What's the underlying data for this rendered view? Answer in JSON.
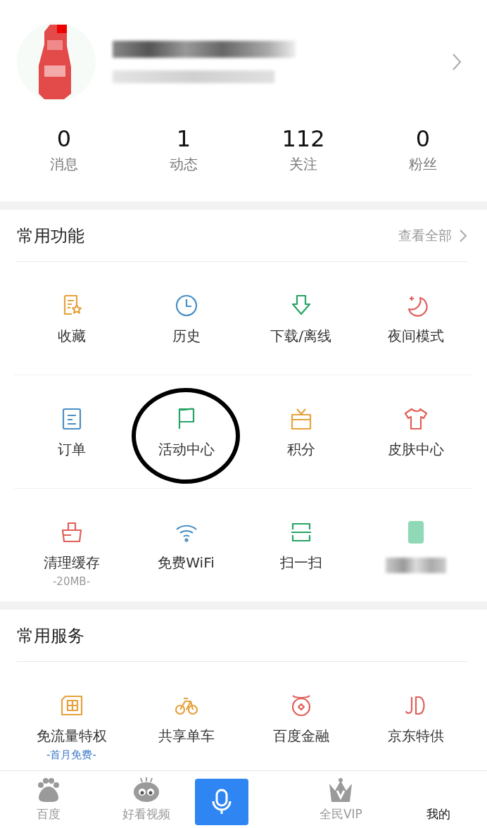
{
  "profile": {
    "stats": [
      {
        "value": "0",
        "label": "消息"
      },
      {
        "value": "1",
        "label": "动态"
      },
      {
        "value": "112",
        "label": "关注"
      },
      {
        "value": "0",
        "label": "粉丝"
      }
    ]
  },
  "common_functions": {
    "title": "常用功能",
    "view_all": "查看全部",
    "items": [
      {
        "label": "收藏",
        "kind": "bookmark",
        "color": "#e6a23c"
      },
      {
        "label": "历史",
        "kind": "clock",
        "color": "#4a8fc4"
      },
      {
        "label": "下载/离线",
        "kind": "download",
        "color": "#27a464"
      },
      {
        "label": "夜间模式",
        "kind": "moon",
        "color": "#e0605a"
      },
      {
        "label": "订单",
        "kind": "order",
        "color": "#4a8fc4"
      },
      {
        "label": "活动中心",
        "kind": "flag",
        "color": "#27a464",
        "circled": true
      },
      {
        "label": "积分",
        "kind": "gift",
        "color": "#e6a23c"
      },
      {
        "label": "皮肤中心",
        "kind": "shirt",
        "color": "#e0605a"
      },
      {
        "label": "清理缓存",
        "sub": "-20MB-",
        "kind": "basket",
        "color": "#e0605a"
      },
      {
        "label": "免费WiFi",
        "kind": "wifi",
        "color": "#4a8fc4"
      },
      {
        "label": "扫一扫",
        "kind": "scan",
        "color": "#27a464"
      },
      {
        "kind": "phone",
        "color": "#8fd9b6",
        "blurred": true
      }
    ]
  },
  "common_services": {
    "title": "常用服务",
    "items": [
      {
        "label": "免流量特权",
        "sub": "-首月免费-",
        "kind": "sim",
        "color": "#e6a23c"
      },
      {
        "label": "共享单车",
        "kind": "bike",
        "color": "#e6a23c"
      },
      {
        "label": "百度金融",
        "kind": "coin",
        "color": "#e0605a"
      },
      {
        "label": "京东特供",
        "kind": "jd",
        "color": "#e0605a"
      }
    ]
  },
  "tab_bar": [
    {
      "label": "百度",
      "kind": "paw",
      "selected": false
    },
    {
      "label": "好看视频",
      "kind": "face",
      "selected": false
    },
    {
      "kind": "mic"
    },
    {
      "label": "全民VIP",
      "kind": "crown",
      "selected": false
    },
    {
      "label": "我的",
      "kind": "plain",
      "selected": true
    }
  ]
}
